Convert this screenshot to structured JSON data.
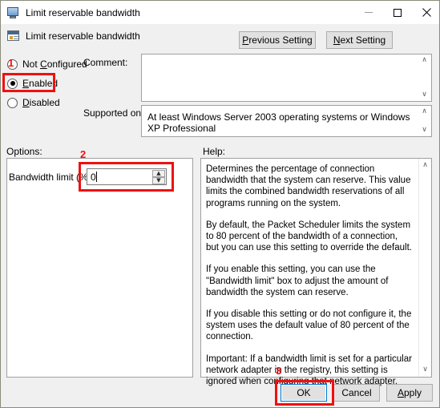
{
  "window": {
    "title": "Limit reservable bandwidth",
    "title_icon": "computer-icon",
    "minimize_label": "–",
    "maximize_label": "□",
    "close_label": "✕"
  },
  "header": {
    "title": "Limit reservable bandwidth",
    "icon": "policy-setting-icon"
  },
  "nav": {
    "previous_prefix": "P",
    "previous_rest": "revious Setting",
    "next_prefix": "N",
    "next_rest": "ext Setting"
  },
  "state": {
    "not_configured_prefix": "Not ",
    "not_configured_accel": "C",
    "not_configured_rest": "onfigured",
    "enabled_accel": "E",
    "enabled_rest": "nabled",
    "disabled_accel": "D",
    "disabled_rest": "isabled",
    "selected": "Enabled"
  },
  "comment": {
    "label": "Comment:",
    "value": "",
    "placeholder": ""
  },
  "supported": {
    "label": "Supported on:",
    "value": "At least Windows Server 2003 operating systems or Windows XP Professional"
  },
  "options": {
    "label": "Options:",
    "bandwidth_label": "Bandwidth limit (%):",
    "bandwidth_value": "0",
    "spin_up": "▲",
    "spin_down": "▼"
  },
  "help": {
    "label": "Help:",
    "paragraphs": [
      "Determines the percentage of connection bandwidth that the system can reserve. This value limits the combined bandwidth reservations of all programs running on the system.",
      "By default, the Packet Scheduler limits the system to 80 percent of the bandwidth of a connection, but you can use this setting to override the default.",
      "If you enable this setting, you can use the \"Bandwidth limit\" box to adjust the amount of bandwidth the system can reserve.",
      "If you disable this setting or do not configure it, the system uses the default value of 80 percent of the connection.",
      "Important: If a bandwidth limit is set for a particular network adapter in the registry, this setting is ignored when configuring that network adapter."
    ],
    "scroll_up": "∧",
    "scroll_down": "∨"
  },
  "footer": {
    "ok_label": "OK",
    "cancel_label": "Cancel",
    "apply_accel": "A",
    "apply_rest": "pply"
  },
  "annotations": {
    "color": "#ee1111",
    "marker_1": "1",
    "marker_2": "2",
    "marker_3": "3"
  }
}
